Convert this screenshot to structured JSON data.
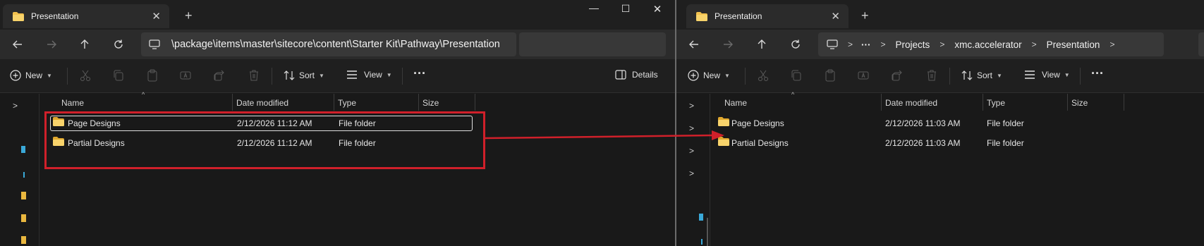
{
  "left": {
    "tab_title": "Presentation",
    "window_controls": {
      "minimize": "—",
      "maximize": "☐",
      "close": "✕"
    },
    "address_path": "\\package\\items\\master\\sitecore\\content\\Starter Kit\\Pathway\\Presentation",
    "toolbar": {
      "new_label": "New",
      "sort_label": "Sort",
      "view_label": "View",
      "more_label": "···",
      "details_label": "Details"
    },
    "columns": {
      "name": "Name",
      "date": "Date modified",
      "type": "Type",
      "size": "Size"
    },
    "rows": [
      {
        "name": "Page Designs",
        "date": "2/12/2026 11:12 AM",
        "type": "File folder"
      },
      {
        "name": "Partial Designs",
        "date": "2/12/2026 11:12 AM",
        "type": "File folder"
      }
    ]
  },
  "right": {
    "tab_title": "Presentation",
    "breadcrumbs": [
      "Projects",
      "xmc.accelerator",
      "Presentation"
    ],
    "more_crumbs": "···",
    "toolbar": {
      "new_label": "New",
      "sort_label": "Sort",
      "view_label": "View",
      "more_label": "···"
    },
    "columns": {
      "name": "Name",
      "date": "Date modified",
      "type": "Type",
      "size": "Size"
    },
    "rows": [
      {
        "name": "Page Designs",
        "date": "2/12/2026 11:03 AM",
        "type": "File folder"
      },
      {
        "name": "Partial Designs",
        "date": "2/12/2026 11:03 AM",
        "type": "File folder"
      }
    ]
  },
  "colors": {
    "annotation_red": "#d0202a",
    "folder_yellow": "#f2c14e"
  },
  "icons": [
    "folder-icon",
    "back-icon",
    "forward-icon",
    "up-icon",
    "refresh-icon",
    "computer-icon",
    "cut-icon",
    "copy-icon",
    "paste-icon",
    "rename-icon",
    "share-icon",
    "delete-icon",
    "sort-icon",
    "view-icon",
    "details-icon",
    "annotation-arrow-icon"
  ]
}
